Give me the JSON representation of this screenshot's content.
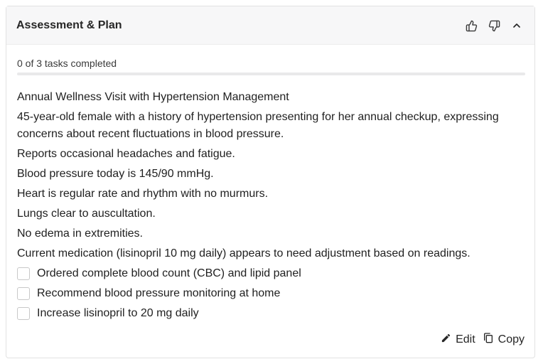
{
  "card": {
    "title": "Assessment & Plan"
  },
  "header_icons": {
    "thumbs_up": "thumbs-up-icon",
    "thumbs_down": "thumbs-down-icon",
    "collapse": "chevron-up-icon"
  },
  "progress": {
    "label": "0 of 3 tasks completed",
    "completed": 0,
    "total": 3
  },
  "assessment": {
    "paragraphs": [
      "Annual Wellness Visit with Hypertension Management",
      "45-year-old female with a history of hypertension presenting for her annual checkup, expressing concerns about recent fluctuations in blood pressure.",
      "Reports occasional headaches and fatigue.",
      "Blood pressure today is 145/90 mmHg.",
      "Heart is regular rate and rhythm with no murmurs.",
      "Lungs clear to auscultation.",
      "No edema in extremities.",
      "Current medication (lisinopril 10 mg daily) appears to need adjustment based on readings."
    ]
  },
  "tasks": [
    {
      "label": "Ordered complete blood count (CBC) and lipid panel",
      "checked": false
    },
    {
      "label": "Recommend blood pressure monitoring at home",
      "checked": false
    },
    {
      "label": "Increase lisinopril to 20 mg daily",
      "checked": false
    }
  ],
  "footer": {
    "edit_label": "Edit",
    "copy_label": "Copy"
  },
  "colors": {
    "progress_fill": "#6b6bd6",
    "header_bg": "#f7f7f8"
  }
}
